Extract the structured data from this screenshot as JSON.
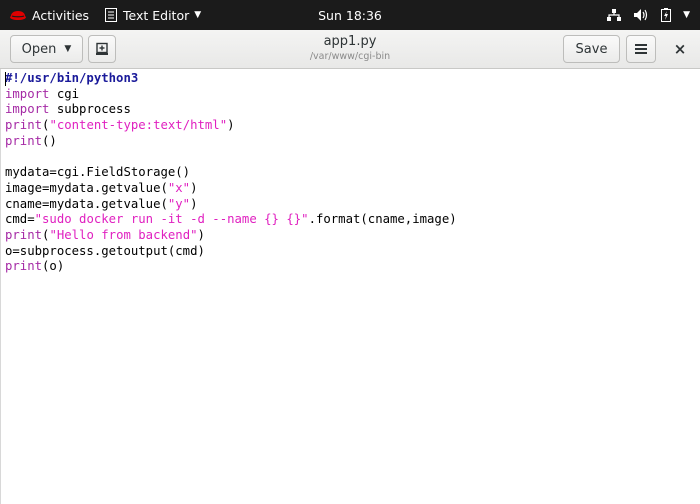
{
  "topbar": {
    "activities_label": "Activities",
    "app_menu_label": "Text Editor",
    "clock": "Sun 18:36",
    "icons": [
      "network-icon",
      "volume-icon",
      "battery-icon",
      "system-menu-caret"
    ]
  },
  "headerbar": {
    "open_label": "Open",
    "title": "app1.py",
    "subtitle": "/var/www/cgi-bin",
    "save_label": "Save",
    "menu_icon": "hamburger-icon",
    "close_icon": "close-icon",
    "close_glyph": "×"
  },
  "editor": {
    "lines": [
      [
        {
          "t": "#!/usr/bin/python3",
          "c": "shebang"
        }
      ],
      [
        {
          "t": "import",
          "c": "kw"
        },
        {
          "t": " cgi",
          "c": "plain"
        }
      ],
      [
        {
          "t": "import",
          "c": "kw"
        },
        {
          "t": " subprocess",
          "c": "plain"
        }
      ],
      [
        {
          "t": "print",
          "c": "kw"
        },
        {
          "t": "(",
          "c": "plain"
        },
        {
          "t": "\"content-type:text/html\"",
          "c": "str"
        },
        {
          "t": ")",
          "c": "plain"
        }
      ],
      [
        {
          "t": "print",
          "c": "kw"
        },
        {
          "t": "()",
          "c": "plain"
        }
      ],
      [],
      [
        {
          "t": "mydata=cgi.FieldStorage()",
          "c": "plain"
        }
      ],
      [
        {
          "t": "image=mydata.getvalue(",
          "c": "plain"
        },
        {
          "t": "\"x\"",
          "c": "str"
        },
        {
          "t": ")",
          "c": "plain"
        }
      ],
      [
        {
          "t": "cname=mydata.getvalue(",
          "c": "plain"
        },
        {
          "t": "\"y\"",
          "c": "str"
        },
        {
          "t": ")",
          "c": "plain"
        }
      ],
      [
        {
          "t": "cmd=",
          "c": "plain"
        },
        {
          "t": "\"sudo docker run -it -d --name {} {}\"",
          "c": "str"
        },
        {
          "t": ".format(cname,image)",
          "c": "plain"
        }
      ],
      [
        {
          "t": "print",
          "c": "kw"
        },
        {
          "t": "(",
          "c": "plain"
        },
        {
          "t": "\"Hello from backend\"",
          "c": "str"
        },
        {
          "t": ")",
          "c": "plain"
        }
      ],
      [
        {
          "t": "o=subprocess.getoutput(cmd)",
          "c": "plain"
        }
      ],
      [
        {
          "t": "print",
          "c": "kw"
        },
        {
          "t": "(o)",
          "c": "plain"
        }
      ]
    ]
  },
  "colors": {
    "topbar_bg": "#1b1b1b",
    "keyword": "#a52aa5",
    "string": "#e020c0",
    "shebang": "#1a1a9a"
  }
}
